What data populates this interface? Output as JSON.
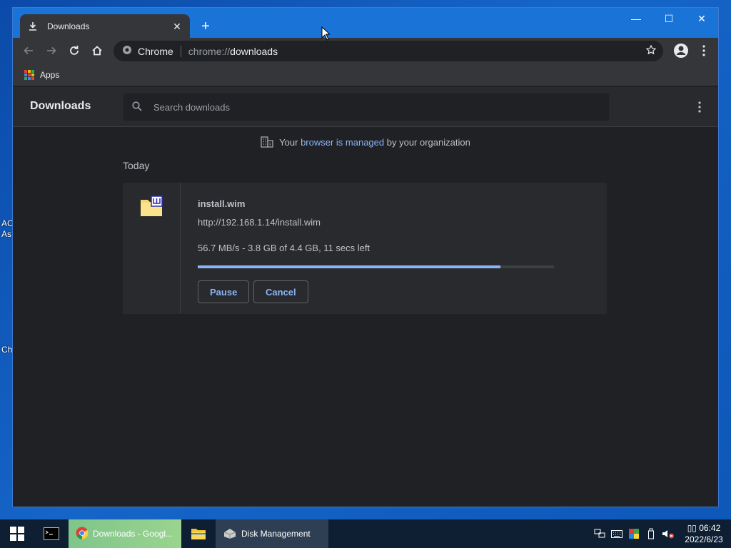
{
  "desktop": {
    "labels": [
      "AC",
      "As",
      "Ch"
    ]
  },
  "tab": {
    "title": "Downloads"
  },
  "toolbar": {
    "origin_label": "Chrome",
    "url_scheme": "chrome://",
    "url_path": "downloads"
  },
  "bookmarks": {
    "apps_label": "Apps"
  },
  "downloads_page": {
    "title": "Downloads",
    "search_placeholder": "Search downloads",
    "managed_prefix": "Your",
    "managed_link": "browser is managed",
    "managed_suffix": "by your organization",
    "date_group": "Today",
    "item": {
      "file_name": "install.wim",
      "url": "http://192.168.1.14/install.wim",
      "status": "56.7 MB/s - 3.8 GB of 4.4 GB, 11 secs left",
      "progress_fraction": 0.85,
      "pause_label": "Pause",
      "cancel_label": "Cancel"
    }
  },
  "taskbar": {
    "chrome_item": "Downloads - Googl...",
    "disk_item": "Disk Management",
    "clock_line1": "▯▯ 06:42",
    "clock_line2": "2022/6/23"
  },
  "colors": {
    "accent": "#8ab4f8",
    "window_titlebar": "#1a73d6",
    "page_bg": "#202124",
    "card_bg": "#292a2d"
  }
}
